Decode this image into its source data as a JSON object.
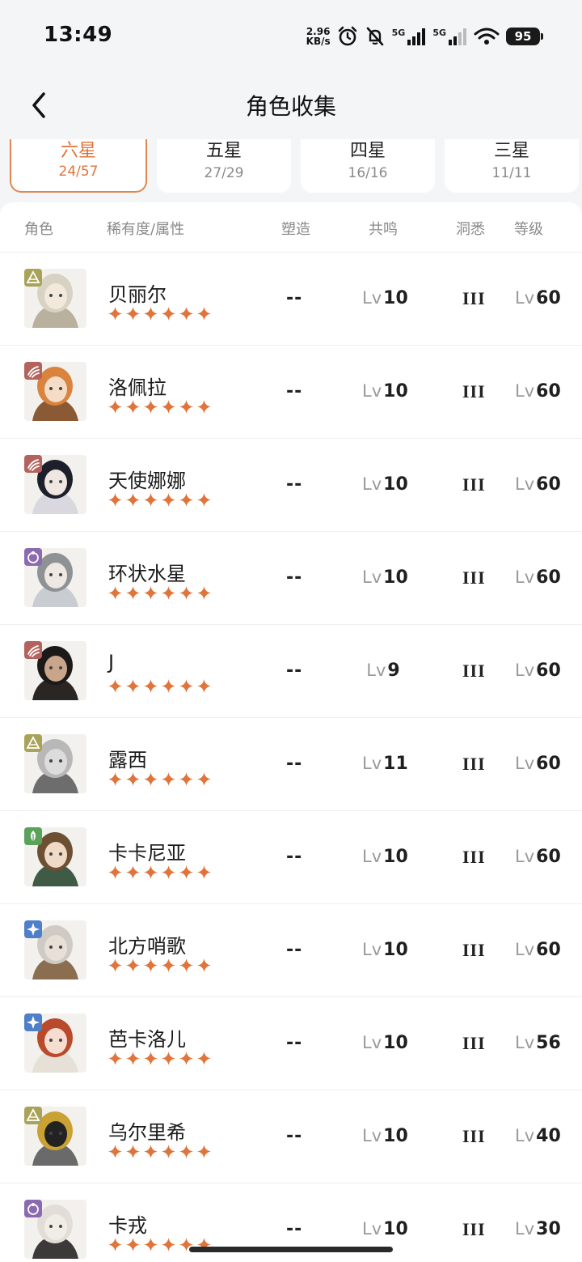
{
  "status_bar": {
    "time": "13:49",
    "net_speed_value": "2.96",
    "net_speed_unit": "KB/s",
    "network_1": "5G",
    "network_2": "5G",
    "battery": "95"
  },
  "header": {
    "title": "角色收集",
    "back_icon": "chevron-left-icon"
  },
  "tabs": [
    {
      "label": "六星",
      "count": "24/57",
      "active": true
    },
    {
      "label": "五星",
      "count": "27/29",
      "active": false
    },
    {
      "label": "四星",
      "count": "16/16",
      "active": false
    },
    {
      "label": "三星",
      "count": "11/11",
      "active": false
    }
  ],
  "columns": {
    "role": "角色",
    "rarity": "稀有度/属性",
    "shaping": "塑造",
    "resonance": "共鸣",
    "insight": "洞悉",
    "level": "等级"
  },
  "level_prefix": "Lv",
  "colors": {
    "accent": "#e0743a",
    "star": "#e0743a",
    "attr_earth": "#a9a35a",
    "attr_beast": "#b3625c",
    "attr_star": "#8b6ab0",
    "attr_plant": "#5aa15a",
    "attr_mineral": "#4f7fc9"
  },
  "characters": [
    {
      "name": "贝丽尔",
      "attr": "earth",
      "attr_icon": "triangle-attr-icon",
      "stars": 6,
      "shaping": "--",
      "resonance": "10",
      "insight": "III",
      "level": "60",
      "portrait": "hair-light"
    },
    {
      "name": "洛佩拉",
      "attr": "beast",
      "attr_icon": "claw-attr-icon",
      "stars": 6,
      "shaping": "--",
      "resonance": "10",
      "insight": "III",
      "level": "60",
      "portrait": "hair-orange"
    },
    {
      "name": "天使娜娜",
      "attr": "beast",
      "attr_icon": "claw-attr-icon",
      "stars": 6,
      "shaping": "--",
      "resonance": "10",
      "insight": "III",
      "level": "60",
      "portrait": "hair-black"
    },
    {
      "name": "环状水星",
      "attr": "star",
      "attr_icon": "ring-attr-icon",
      "stars": 6,
      "shaping": "--",
      "resonance": "10",
      "insight": "III",
      "level": "60",
      "portrait": "hair-gray"
    },
    {
      "name": "J",
      "attr": "beast",
      "attr_icon": "claw-attr-icon",
      "stars": 6,
      "shaping": "--",
      "resonance": "9",
      "insight": "III",
      "level": "60",
      "portrait": "hair-dark"
    },
    {
      "name": "露西",
      "attr": "earth",
      "attr_icon": "triangle-attr-icon",
      "stars": 6,
      "shaping": "--",
      "resonance": "11",
      "insight": "III",
      "level": "60",
      "portrait": "robot-silver"
    },
    {
      "name": "卡卡尼亚",
      "attr": "plant",
      "attr_icon": "leaf-attr-icon",
      "stars": 6,
      "shaping": "--",
      "resonance": "10",
      "insight": "III",
      "level": "60",
      "portrait": "hat-brown"
    },
    {
      "name": "北方哨歌",
      "attr": "mineral",
      "attr_icon": "spark-attr-icon",
      "stars": 6,
      "shaping": "--",
      "resonance": "10",
      "insight": "III",
      "level": "60",
      "portrait": "hair-white"
    },
    {
      "name": "芭卡洛儿",
      "attr": "mineral",
      "attr_icon": "spark-attr-icon",
      "stars": 6,
      "shaping": "--",
      "resonance": "10",
      "insight": "III",
      "level": "56",
      "portrait": "hair-red"
    },
    {
      "name": "乌尔里希",
      "attr": "earth",
      "attr_icon": "triangle-attr-icon",
      "stars": 6,
      "shaping": "--",
      "resonance": "10",
      "insight": "III",
      "level": "40",
      "portrait": "clock-gold"
    },
    {
      "name": "卡戎",
      "attr": "star",
      "attr_icon": "ring-attr-icon",
      "stars": 6,
      "shaping": "--",
      "resonance": "10",
      "insight": "III",
      "level": "30",
      "portrait": "cloak-white"
    }
  ]
}
